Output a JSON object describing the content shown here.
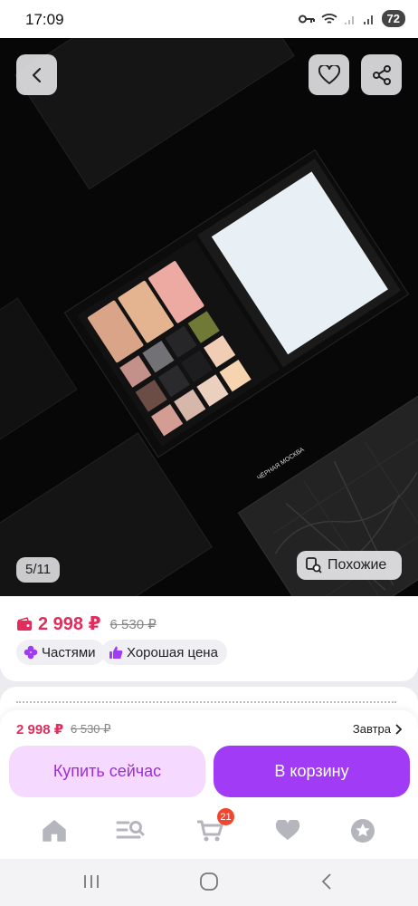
{
  "status_bar": {
    "time": "17:09",
    "battery": "72"
  },
  "gallery": {
    "counter": "5/11",
    "similar_label": "Похожие",
    "product_print": "ЧЁРНАЯ МОСКВА"
  },
  "price_card": {
    "price": "2 998 ₽",
    "old_price": "6 530 ₽",
    "badges": [
      {
        "label": "Частями",
        "icon": "installments-icon"
      },
      {
        "label": "Хорошая цена",
        "icon": "thumbs-up-icon"
      }
    ]
  },
  "buy_panel": {
    "price": "2 998 ₽",
    "old_price": "6 530 ₽",
    "delivery": "Завтра",
    "buy_now_label": "Купить сейчас",
    "add_to_cart_label": "В корзину"
  },
  "tab_bar": {
    "items": [
      "home-icon",
      "catalog-search-icon",
      "cart-icon",
      "favorites-heart-icon",
      "profile-star-icon"
    ],
    "cart_count": "21"
  },
  "colors": {
    "price": "#e02d5d",
    "accent": "#a13bf5",
    "accent_soft": "#f5d9ff",
    "badge_red": "#f2452e"
  }
}
